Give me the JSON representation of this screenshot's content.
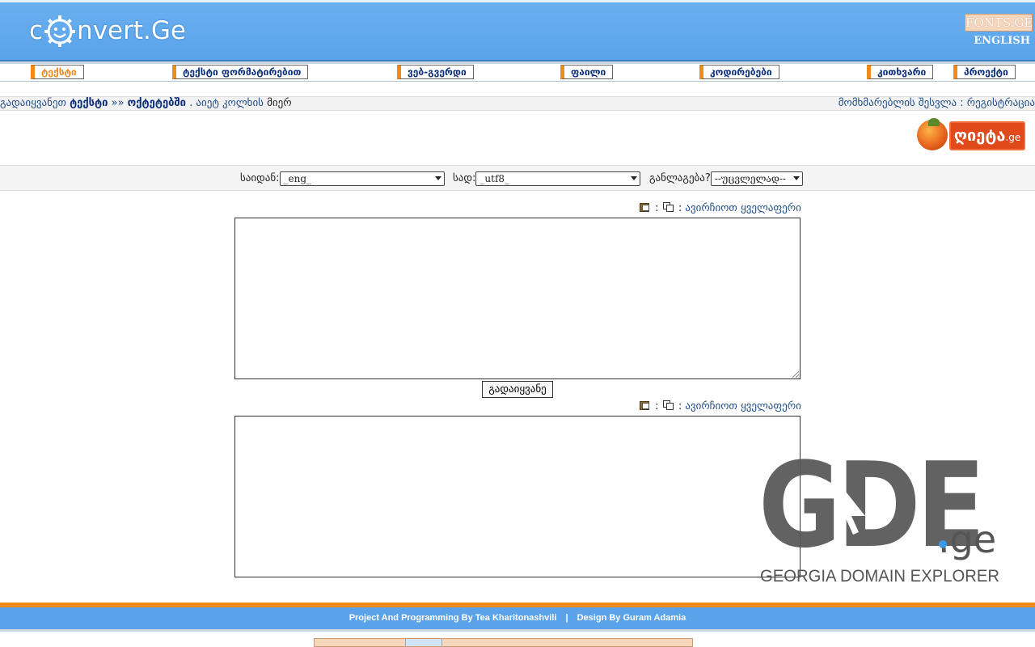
{
  "header": {
    "logo_prefix": "c",
    "logo_suffix": "nvert.Ge",
    "fonts_badge": "FONTS.GE",
    "english_link": "ENGLISH"
  },
  "nav": {
    "tabs": [
      {
        "label": "ტექსტი",
        "active": true
      },
      {
        "label": "ტექსტი ფორმატირებით",
        "active": false
      },
      {
        "label": "ვებ-გვერდი",
        "active": false
      },
      {
        "label": "ფაილი",
        "active": false
      },
      {
        "label": "კოდირებები",
        "active": false
      },
      {
        "label": "კითხვარი",
        "active": false
      },
      {
        "label": "პროექტი",
        "active": false
      }
    ]
  },
  "breadcrumb": {
    "prefix": "გადაიყვანეთ",
    "item1": "ტექსტი",
    "arrow": "»»",
    "item2": "ოქტეტებში",
    "by": ". აიეტ კოლხის",
    "suffix": "მიერ",
    "login": "მომხმარებლის შესვლა",
    "colon": ":",
    "register": "რეგისტრაცია"
  },
  "ad": {
    "brand": "ღიეტა",
    "tld": ".ge"
  },
  "options": {
    "from_label": "საიდან:",
    "from_value": "_eng_",
    "to_label": "სად:",
    "to_value": "_utf8_",
    "layout_label": "განლაგება?",
    "layout_value": "--უცვლელად--"
  },
  "actions": {
    "separator": ":",
    "select_all": "ავირჩიოთ ყველაფერი"
  },
  "input_text": "",
  "output_text": "",
  "convert_button": "გადაიყვანე",
  "watermark": {
    "main": "GDE",
    "tld": ".ge",
    "tagline": "GEORGIA DOMAIN EXPLORER"
  },
  "footer": {
    "programming": "Project And Programming By Tea Kharitonashvili",
    "pipe": "|",
    "design": "Design By Guram Adamia"
  },
  "colors": {
    "header_blue": "#5aa3ea",
    "accent_orange": "#f08a1c",
    "link_blue": "#1f4d87"
  }
}
